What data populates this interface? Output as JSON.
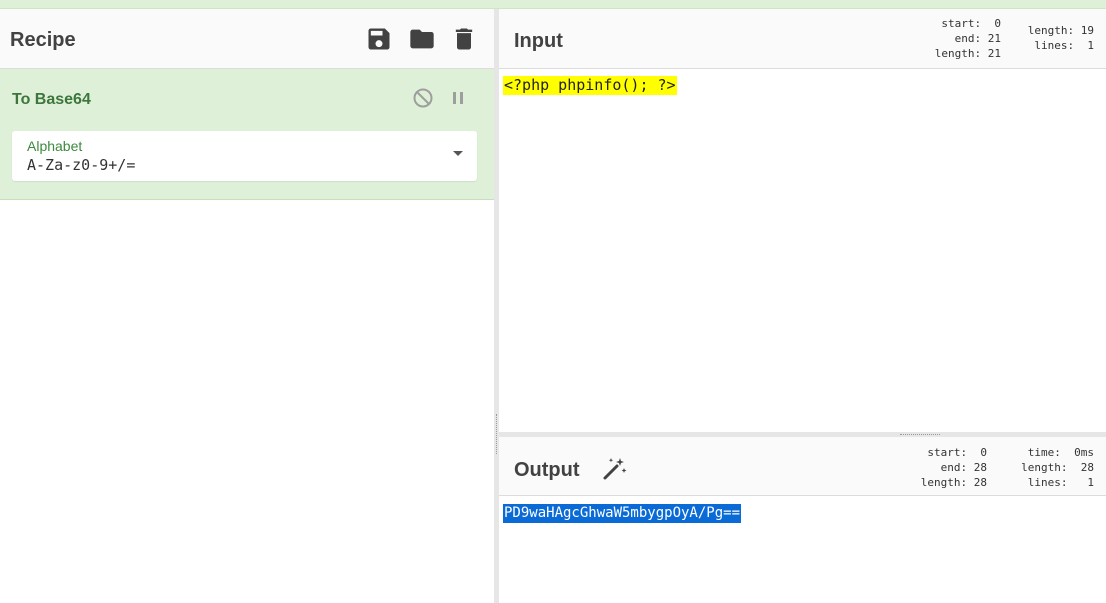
{
  "recipe": {
    "title": "Recipe",
    "icons": [
      "save-icon",
      "folder-icon",
      "trash-icon"
    ]
  },
  "operation": {
    "name": "To Base64",
    "arg_label": "Alphabet",
    "arg_value": "A-Za-z0-9+/=",
    "icons": [
      "disable-icon",
      "pause-icon"
    ]
  },
  "input": {
    "title": "Input",
    "text": "<?php phpinfo(); ?>",
    "sel_stats": "start:  0\nend: 21\nlength: 21",
    "doc_stats": "length: 19\nlines:  1"
  },
  "output": {
    "title": "Output",
    "text": "PD9waHAgcGhwaW5mbygpOyA/Pg==",
    "sel_stats": "start:  0\nend: 28\nlength: 28",
    "doc_stats": "time:  0ms\nlength:  28\nlines:   1",
    "icons": [
      "magic-wand-icon"
    ]
  },
  "colors": {
    "accent_green": "#3c763d",
    "op_background": "#dff0d8",
    "input_highlight": "#ffff00",
    "output_selection": "#0a6ad6"
  }
}
